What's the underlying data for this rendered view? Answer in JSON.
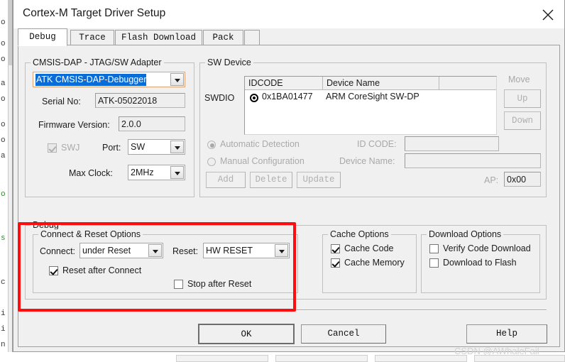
{
  "window": {
    "title": "Cortex-M Target Driver Setup",
    "close_icon": "close-x-icon"
  },
  "tabs": [
    {
      "label": "Debug",
      "active": true
    },
    {
      "label": "Trace",
      "active": false
    },
    {
      "label": "Flash Download",
      "active": false
    },
    {
      "label": "Pack",
      "active": false
    }
  ],
  "adapter_group": {
    "title": "CMSIS-DAP - JTAG/SW Adapter",
    "debugger_combo": {
      "value": "ATK CMSIS-DAP-Debugger",
      "selected": true
    },
    "serial_no": {
      "label": "Serial No:",
      "value": "ATK-05022018"
    },
    "firmware_version": {
      "label": "Firmware Version:",
      "value": "2.0.0"
    },
    "swj": {
      "label": "SWJ",
      "checked": true,
      "enabled": false
    },
    "port": {
      "label": "Port:",
      "value": "SW"
    },
    "max_clock": {
      "label": "Max Clock:",
      "value": "2MHz"
    }
  },
  "sw_device_group": {
    "title": "SW Device",
    "swdio_label": "SWDIO",
    "columns": [
      "IDCODE",
      "Device Name",
      ""
    ],
    "rows": [
      {
        "idcode": "0x1BA01477",
        "device_name": "ARM CoreSight SW-DP",
        "selected": true
      }
    ],
    "move_label": "Move",
    "up_button": "Up",
    "down_button": "Down",
    "automatic_detection": {
      "label": "Automatic Detection",
      "selected": true
    },
    "manual_configuration": {
      "label": "Manual Configuration",
      "selected": false
    },
    "id_code": {
      "label": "ID CODE:",
      "value": ""
    },
    "device_name": {
      "label": "Device Name:",
      "value": ""
    },
    "add_button": "Add",
    "delete_button": "Delete",
    "update_button": "Update",
    "ap": {
      "label": "AP:",
      "value": "0x00"
    }
  },
  "debug_group": {
    "title": "Debug",
    "connect_reset_options": {
      "title": "Connect & Reset Options",
      "connect": {
        "label": "Connect:",
        "value": "under Reset"
      },
      "reset": {
        "label": "Reset:",
        "value": "HW RESET"
      },
      "reset_after_connect": {
        "label": "Reset after Connect",
        "accel": "R",
        "checked": true
      },
      "stop_after_reset": {
        "label": "Stop after Reset",
        "accel": "",
        "checked": false
      }
    },
    "cache_options": {
      "title": "Cache Options",
      "cache_code": {
        "label": "Cache Code",
        "accel": "C",
        "checked": true
      },
      "cache_memory": {
        "label": "Cache Memory",
        "accel": "M",
        "checked": true
      }
    },
    "download_options": {
      "title": "Download Options",
      "verify_code_download": {
        "label": "Verify Code Download",
        "accel": "V",
        "checked": false
      },
      "download_to_flash": {
        "label": "Download to Flash",
        "accel": "F",
        "checked": false
      }
    }
  },
  "footer": {
    "ok_button": "OK",
    "cancel_button": "Cancel",
    "help_button": "Help"
  },
  "watermark": "CSDN @AWhaleFail",
  "background_editor": {
    "visible_chars": [
      "o",
      "o",
      "o",
      "a",
      "o",
      "o",
      "o",
      "a",
      "o",
      "s",
      "c",
      "i",
      "i",
      "n"
    ]
  },
  "colors": {
    "annotation_red": "#fd0d0d",
    "selection_blue": "#0a6cd6",
    "dialog_face": "#f0f0f0",
    "disabled_text": "#a8a8a8"
  }
}
